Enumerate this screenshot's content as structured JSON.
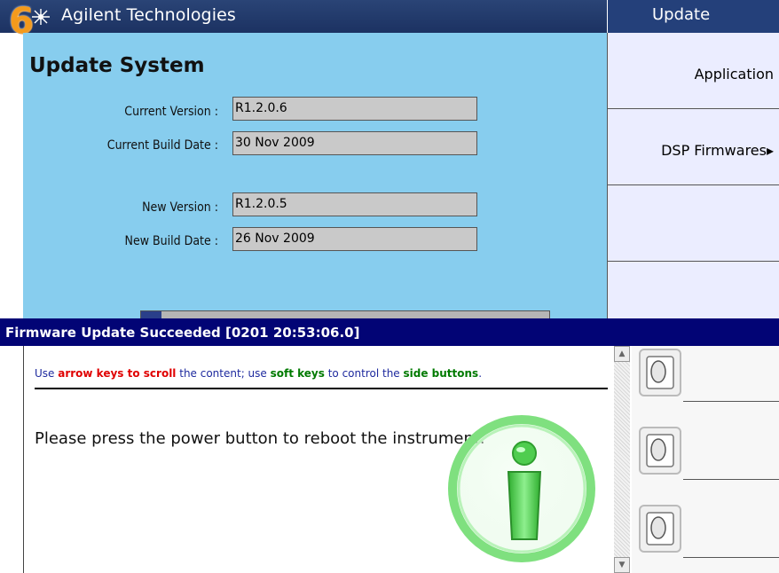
{
  "header": {
    "app_title": "Agilent Technologies",
    "step_badge": "6",
    "logo_icon": "agilent-spark-icon"
  },
  "main": {
    "page_title": "Update System",
    "current_version_label": "Current Version :",
    "current_version_value": "R1.2.0.6",
    "current_build_date_label": "Current Build Date :",
    "current_build_date_value": "30 Nov 2009",
    "new_version_label": "New Version :",
    "new_version_value": "R1.2.0.5",
    "new_build_date_label": "New Build Date :",
    "new_build_date_value": "26 Nov 2009",
    "progress_fraction": 0.05
  },
  "softkeys": {
    "header": "Update",
    "items": [
      {
        "label": "Application"
      },
      {
        "label": "DSP Firmwares▸"
      },
      {
        "label": ""
      },
      {
        "label": ""
      }
    ]
  },
  "dialog": {
    "title": "Firmware Update Succeeded [0201 20:53:06.0]",
    "hint": {
      "part1": "Use ",
      "part2": "arrow keys to scroll",
      "part3": " the content; use ",
      "part4": "soft keys",
      "part5": " to control the ",
      "part6": "side buttons",
      "part7": "."
    },
    "message": "Please press the power button to reboot the instrument.",
    "icon": "info-icon",
    "scroll_up_icon": "scroll-up-arrow-icon",
    "scroll_down_icon": "scroll-down-arrow-icon",
    "side_button_icon": "side-button-icon"
  },
  "colors": {
    "title_bar": "#1c3262",
    "main_panel": "#87cdee",
    "softkey_bg": "#ebedff",
    "dialog_title": "#020475",
    "hint_red": "#e00000",
    "hint_green": "#007a00",
    "badge_orange": "#f39a1c",
    "info_green": "#5ed65e"
  }
}
